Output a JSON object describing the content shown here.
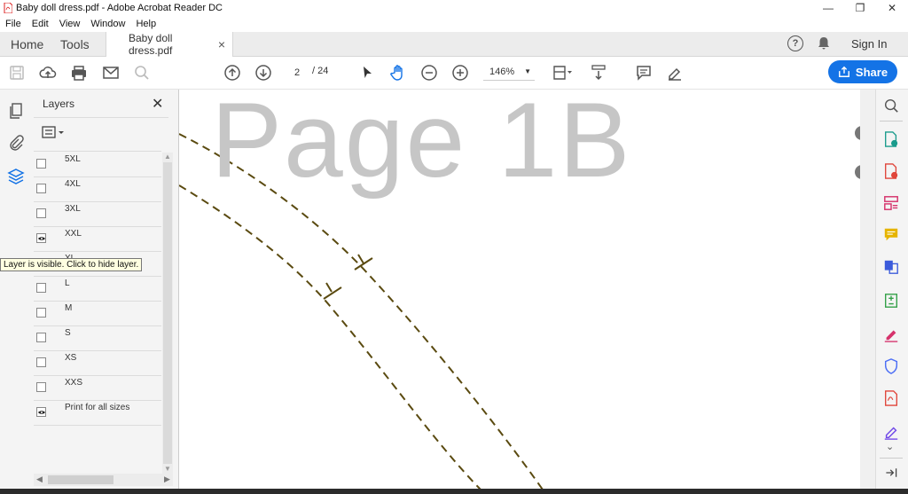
{
  "window": {
    "title": "Baby doll dress.pdf - Adobe Acrobat Reader DC",
    "minimize_glyph": "—",
    "restore_glyph": "❐",
    "close_glyph": "✕"
  },
  "menu": [
    "File",
    "Edit",
    "View",
    "Window",
    "Help"
  ],
  "tabs": {
    "home": "Home",
    "tools": "Tools",
    "document": "Baby doll dress.pdf",
    "document_close": "×",
    "sign_in": "Sign In"
  },
  "toolbar": {
    "page_current": "2",
    "page_total": "/  24",
    "zoom": "146%",
    "share_label": "Share"
  },
  "layers_panel": {
    "title": "Layers",
    "close_glyph": "✕",
    "items": [
      {
        "label": "5XL",
        "visible": false
      },
      {
        "label": "4XL",
        "visible": false
      },
      {
        "label": "3XL",
        "visible": false
      },
      {
        "label": "XXL",
        "visible": true
      },
      {
        "label": "XL",
        "visible": false
      },
      {
        "label": "L",
        "visible": false
      },
      {
        "label": "M",
        "visible": false
      },
      {
        "label": "S",
        "visible": false
      },
      {
        "label": "XS",
        "visible": false
      },
      {
        "label": "XXS",
        "visible": false
      },
      {
        "label": "Print for all sizes",
        "visible": true
      }
    ],
    "tooltip": "Layer is visible. Click to hide layer."
  },
  "document": {
    "watermark": "Page 1B",
    "line_color": "#5a4a10"
  },
  "colors": {
    "accent": "#1473e6",
    "share_bg": "#1473e6"
  }
}
